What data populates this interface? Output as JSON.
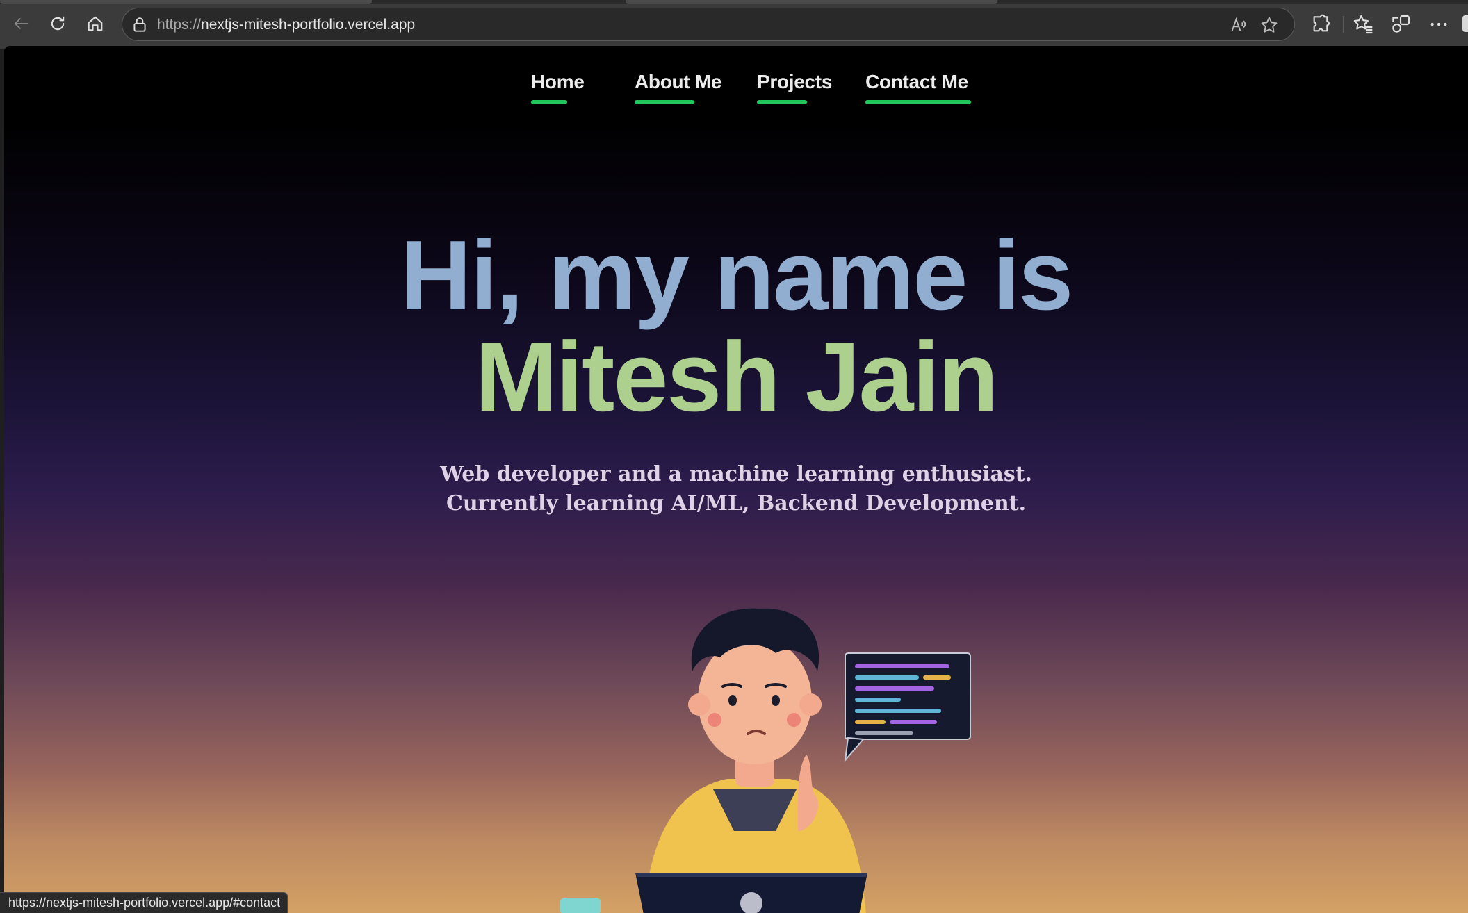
{
  "browser": {
    "url_protocol": "https://",
    "url_host": "nextjs-mitesh-portfolio.vercel.app",
    "read_aloud_label": "A",
    "status_url": "https://nextjs-mitesh-portfolio.vercel.app/#contact"
  },
  "nav": {
    "links": [
      {
        "label": "Home"
      },
      {
        "label": "About Me"
      },
      {
        "label": "Projects"
      },
      {
        "label": "Contact Me"
      }
    ],
    "underline_color": "#22c55e"
  },
  "hero": {
    "line1": "Hi, my name is",
    "line2": "Mitesh Jain",
    "line1_color": "#91aed0",
    "line2_color": "#aed08f"
  },
  "subtitle": {
    "line1": "Web developer and a machine learning enthusiast.",
    "line2": "Currently learning AI/ML, Backend Development."
  },
  "illustration": {
    "name": "developer-thinking-illustration",
    "speech_bubble": "code-speech-bubble"
  },
  "icons": {
    "back": "back-arrow-icon",
    "reload": "reload-icon",
    "home": "home-icon",
    "lock": "lock-icon",
    "read_aloud": "read-aloud-icon",
    "favorite": "star-icon",
    "extensions": "puzzle-icon",
    "favorites_list": "favorites-icon",
    "collections": "collections-icon",
    "more": "more-icon"
  }
}
